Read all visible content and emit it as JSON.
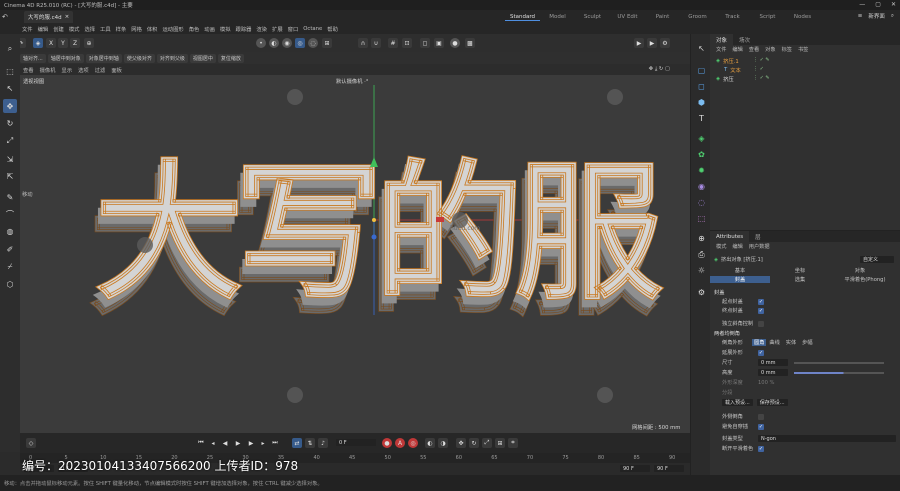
{
  "window": {
    "title": "Cinema 4D R25.010 (RC) - [大写的服.c4d] - 主要",
    "controls": [
      "—",
      "▢",
      "✕"
    ]
  },
  "doc_tab": "大写的服.c4d",
  "layouts": [
    "Standard",
    "Model",
    "Sculpt",
    "UV Edit",
    "Paint",
    "Groom",
    "Track",
    "Script",
    "Nodes"
  ],
  "layout_active": "Standard",
  "new_interface": "新界面",
  "menu": [
    "文件",
    "编辑",
    "创建",
    "模式",
    "选择",
    "工具",
    "样条",
    "网格",
    "体积",
    "运动图形",
    "角色",
    "动画",
    "模拟",
    "跟踪器",
    "渲染",
    "扩展",
    "窗口",
    "Octane",
    "帮助"
  ],
  "toolbar": {
    "axes": [
      "X",
      "Y",
      "Z"
    ]
  },
  "subbar": [
    "轴对齐...",
    "轴居中到对象",
    "对象居中到轴",
    "使父级对齐",
    "对齐到父级",
    "视图居中",
    "复位缩放"
  ],
  "viewport_menu": [
    "查看",
    "摄像机",
    "显示",
    "选项",
    "过滤",
    "面板"
  ],
  "viewport": {
    "view_name": "透视视图",
    "camera": "默认摄像机 ·°",
    "grid_spacing": "网格间距 : 500 mm",
    "move_label": "移动",
    "text_3d": "大写的服",
    "watermark_text": "huitu.com"
  },
  "timeline": {
    "frame_field": "0 F",
    "ruler": [
      "0",
      "5",
      "10",
      "15",
      "20",
      "25",
      "30",
      "35",
      "40",
      "45",
      "50",
      "55",
      "60",
      "65",
      "70",
      "75",
      "80",
      "85",
      "90"
    ],
    "frame_start": "0 F",
    "frame_start2": "0 F",
    "frame_end": "90 F",
    "frame_end2": "90 F"
  },
  "watermark": "编号：20230104133407566200 上传者ID：978",
  "status": "移动：点击并拖动鼠标移动元素。按住 SHIFT 键量化移动，节点编辑模式时按住 SHIFT 键增加选择对象，按住 CTRL 键减少选择对象。",
  "object_manager": {
    "tabs": [
      "对象",
      "场次"
    ],
    "menu": [
      "文件",
      "编辑",
      "查看",
      "对象",
      "标签",
      "书签"
    ],
    "objects": [
      {
        "name": "挤压.1",
        "depth": 0
      },
      {
        "name": "文本",
        "depth": 1
      },
      {
        "name": "挤压",
        "depth": 0
      }
    ]
  },
  "attributes": {
    "tabs": [
      "Attributes",
      "层"
    ],
    "menu": [
      "模式",
      "编辑",
      "用户数据"
    ],
    "object_title": "挤出对象 [挤压.1]",
    "preset": "自定义",
    "subtabs_row1": [
      "基本",
      "坐标",
      "对象"
    ],
    "subtabs_row2": [
      "封盖",
      "选集",
      "平滑着色(Phong)"
    ],
    "section_caps": "封盖",
    "start_cap": "起点封盖",
    "end_cap": "终点封盖",
    "independent_bevel": "独立斜角控制",
    "section_bevel": "两者均倒角",
    "bevel_shape_label": "倒角外形",
    "bevel_shapes": [
      "圆角",
      "曲线",
      "实体",
      "步幅"
    ],
    "extend_shape": "延展外形",
    "size_label": "尺寸",
    "size_value": "0 mm",
    "height_label": "高度",
    "height_value": "0 mm",
    "shape_depth_label": "外形深度",
    "shape_depth_value": "100 %",
    "subdivision_label": "分段",
    "load_preset": "载入预设...",
    "save_preset": "保存预设...",
    "outer_bevel": "外侧倒角",
    "avoid_intersect": "避免自穿插",
    "cap_type_label": "封盖类型",
    "cap_type_value": "N-gon",
    "break_phong": "断开平滑着色"
  }
}
